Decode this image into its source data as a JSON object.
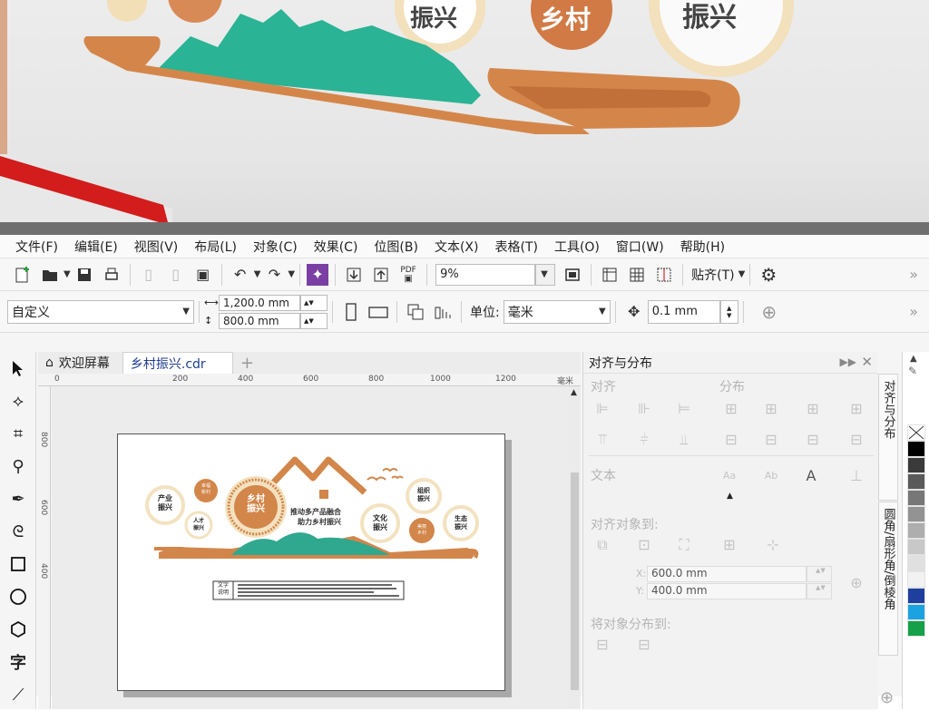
{
  "photo": {
    "sign_fragments": [
      "振兴",
      "乡村",
      "振兴"
    ]
  },
  "menu": [
    "文件(F)",
    "编辑(E)",
    "视图(V)",
    "布局(L)",
    "对象(C)",
    "效果(C)",
    "位图(B)",
    "文本(X)",
    "表格(T)",
    "工具(O)",
    "窗口(W)",
    "帮助(H)"
  ],
  "toolbar1": {
    "zoom": "9%",
    "snap_label": "贴齐(T)",
    "pdf_label": "PDF"
  },
  "toolbar2": {
    "preset": "自定义",
    "width": "1,200.0 mm",
    "height": "800.0 mm",
    "unit_label": "单位:",
    "unit_value": "毫米",
    "nudge": "0.1 mm"
  },
  "tabs": {
    "welcome": "欢迎屏幕",
    "doc": "乡村振兴.cdr",
    "add": "+"
  },
  "ruler": {
    "h_ticks": [
      "0",
      "200",
      "400",
      "600",
      "800",
      "1000",
      "1200"
    ],
    "h_unit": "毫米",
    "v_ticks": [
      "800",
      "600",
      "400"
    ]
  },
  "design": {
    "main_circle": "乡村\n振兴",
    "center_line1": "推动多产品融合",
    "center_line2": "助力乡村振兴",
    "bubbles": [
      "产业\n振兴",
      "幸福\n新村",
      "人才\n振兴",
      "组织\n振兴",
      "文化\n振兴",
      "美丽\n乡村",
      "生态\n振兴"
    ],
    "label_box": "文字\n说明"
  },
  "docker": {
    "title": "对齐与分布",
    "align_label": "对齐",
    "distribute_label": "分布",
    "text_label": "文本",
    "align_to_label": "对齐对象到:",
    "x_label": "X:",
    "x_value": "600.0 mm",
    "y_label": "Y:",
    "y_value": "400.0 mm",
    "distribute_to_label": "将对象分布到:"
  },
  "vtabs": [
    "对齐与分布",
    "圆角/扇形角/倒棱角"
  ],
  "palette": [
    "#ffffff",
    "#000000",
    "#3a3a3a",
    "#5a5a5a",
    "#777777",
    "#939393",
    "#aeaeae",
    "#c8c8c8",
    "#e0e0e0",
    "#f2f2f2",
    "#1f3f9f",
    "#1aa3e0",
    "#15a04a"
  ],
  "colors": {
    "orange": "#d2864a",
    "teal": "#2fa88f",
    "cream": "#f3e2c0"
  }
}
